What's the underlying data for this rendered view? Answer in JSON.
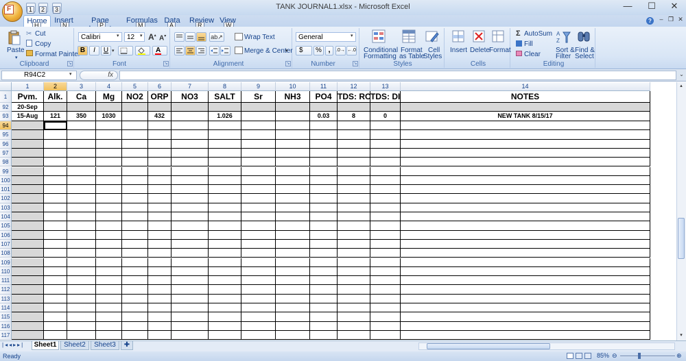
{
  "window": {
    "title": "TANK JOURNAL1.xlsx - Microsoft Excel",
    "minimize": "—",
    "maximize": "☐",
    "close": "✕"
  },
  "qat": {
    "keytips": [
      "1",
      "2",
      "3"
    ]
  },
  "office_button": {
    "keytip": "F"
  },
  "tabs": [
    {
      "label": "Home",
      "keytip": "H"
    },
    {
      "label": "Insert",
      "keytip": "N"
    },
    {
      "label": "Page Layout",
      "keytip": "P"
    },
    {
      "label": "Formulas",
      "keytip": "M"
    },
    {
      "label": "Data",
      "keytip": "A"
    },
    {
      "label": "Review",
      "keytip": "R"
    },
    {
      "label": "View",
      "keytip": "W"
    }
  ],
  "ribbon": {
    "clipboard": {
      "label": "Clipboard",
      "paste": "Paste",
      "cut": "Cut",
      "copy": "Copy",
      "format_painter": "Format Painter"
    },
    "font": {
      "label": "Font",
      "family": "Calibri",
      "size": "12",
      "bold": "B",
      "italic": "I",
      "underline": "U"
    },
    "alignment": {
      "label": "Alignment",
      "wrap": "Wrap Text",
      "merge": "Merge & Center"
    },
    "number": {
      "label": "Number",
      "format": "General",
      "currency": "$",
      "percent": "%",
      "comma": ","
    },
    "styles": {
      "label": "Styles",
      "conditional": "Conditional",
      "conditional2": "Formatting",
      "format_table": "Format",
      "format_table2": "as Table",
      "cell_styles": "Cell",
      "cell_styles2": "Styles"
    },
    "cells": {
      "label": "Cells",
      "insert": "Insert",
      "delete": "Delete",
      "format": "Format"
    },
    "editing": {
      "label": "Editing",
      "autosum": "AutoSum",
      "fill": "Fill",
      "clear": "Clear",
      "sort": "Sort &",
      "sort2": "Filter",
      "find": "Find &",
      "find2": "Select"
    }
  },
  "formula_bar": {
    "name_box": "R94C2",
    "fx": "fx",
    "value": ""
  },
  "columns": [
    "1",
    "2",
    "3",
    "4",
    "5",
    "6",
    "7",
    "8",
    "9",
    "10",
    "11",
    "12",
    "13",
    "14"
  ],
  "header_row": {
    "num": "1",
    "cells": [
      "Pvm.",
      "Alk.",
      "Ca",
      "Mg",
      "NO2",
      "ORP",
      "NO3",
      "SALT",
      "Sr",
      "NH3",
      "PO4",
      "TDS: RO",
      "TDS: DI",
      "NOTES"
    ]
  },
  "data_rows": [
    {
      "num": "92",
      "cells": [
        "20-Sep",
        "",
        "",
        "",
        "",
        "",
        "",
        "",
        "",
        "",
        "",
        "",
        "",
        ""
      ]
    },
    {
      "num": "93",
      "cells": [
        "15-Aug",
        "121",
        "350",
        "1030",
        "",
        "432",
        "",
        "1.026",
        "",
        "",
        "0.03",
        "8",
        "0",
        "NEW TANK 8/15/17"
      ]
    }
  ],
  "empty_rows": [
    "94",
    "95",
    "96",
    "97",
    "98",
    "99",
    "100",
    "101",
    "102",
    "103",
    "104",
    "105",
    "106",
    "107",
    "108",
    "109",
    "110",
    "111",
    "112",
    "113",
    "114",
    "115",
    "116",
    "117"
  ],
  "sheets": [
    "Sheet1",
    "Sheet2",
    "Sheet3"
  ],
  "status": {
    "ready": "Ready",
    "zoom": "85%"
  }
}
